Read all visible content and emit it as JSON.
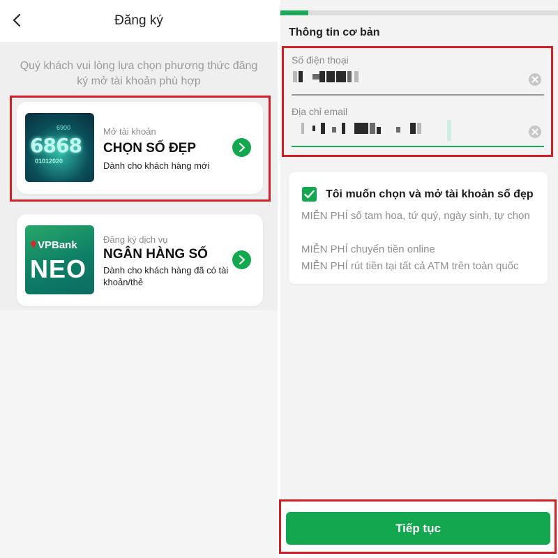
{
  "left": {
    "header": {
      "title": "Đăng ký"
    },
    "intro": "Quý khách vui lòng lựa chọn phương thức đăng ký mở tài khoản phù hợp",
    "cards": [
      {
        "subtitle": "Mở tài khoản",
        "title": "CHỌN SỐ ĐẸP",
        "description": "Dành cho khách hàng mới",
        "thumb": {
          "big": "6868",
          "tiny": "6900",
          "small": "01012020"
        }
      },
      {
        "subtitle": "Đăng ký dịch vụ",
        "title": "NGÂN HÀNG SỐ",
        "description": "Dành cho khách hàng đã có tài khoản/thẻ",
        "thumb": {
          "brand": "VPBank",
          "product": "NEO"
        }
      }
    ]
  },
  "right": {
    "progress": 0.1,
    "section_title": "Thông tin cơ bản",
    "phone_field": {
      "label": "Số điện thoại"
    },
    "email_field": {
      "label": "Địa chỉ email"
    },
    "promo": {
      "checked": true,
      "title": "Tôi muốn chọn và mở tài khoản số đẹp",
      "lines": [
        "MIỄN PHÍ số tam hoa, tứ quý, ngày sinh, tự chọn",
        "MIỄN PHÍ chuyển tiền online",
        "MIỄN PHÍ rút tiền tại tất cả ATM trên toàn quốc"
      ]
    },
    "continue_label": "Tiếp tục"
  },
  "colors": {
    "accent": "#13a84f",
    "highlight": "#d21f26"
  }
}
